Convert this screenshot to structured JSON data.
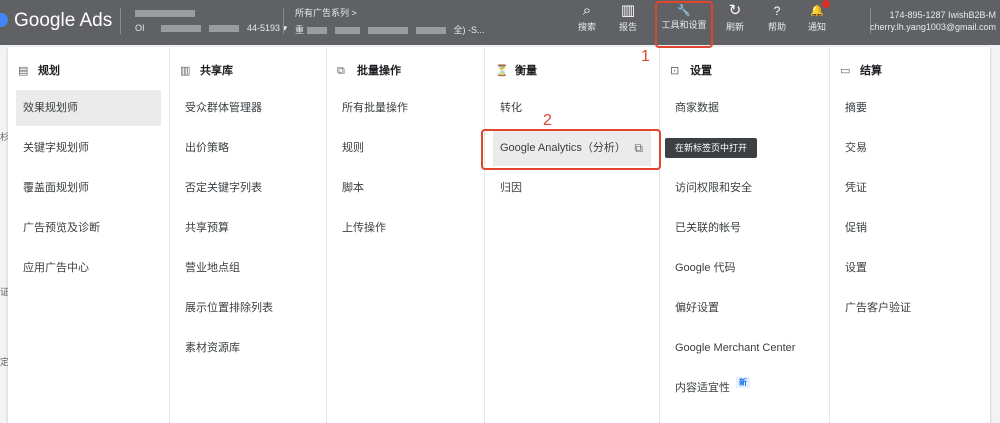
{
  "header": {
    "logo": "Google Ads",
    "account_line1": "",
    "account_line2_prefix": "OI",
    "account_id_suffix": "44-5193",
    "campaign_label": "所有广告系列 >",
    "campaign_name_prefix": "重",
    "campaign_name_suffix": "全) -S...",
    "toolbar": [
      {
        "icon": "search-icon",
        "glyph": "⌕",
        "label": "搜索"
      },
      {
        "icon": "reports-icon",
        "glyph": "▥",
        "label": "报告"
      },
      {
        "icon": "wrench-icon",
        "glyph": "🔧",
        "label": "工具和设置"
      },
      {
        "icon": "refresh-icon",
        "glyph": "↻",
        "label": "刷新"
      },
      {
        "icon": "help-icon",
        "glyph": "?",
        "label": "帮助"
      },
      {
        "icon": "bell-icon",
        "glyph": "🔔",
        "label": "通知"
      }
    ],
    "user_line1": "174-895-1287 IwishB2B-M",
    "user_line2": "cherry.lh.yang1003@gmail.com"
  },
  "menu": {
    "columns": [
      {
        "title": "规划",
        "icon": "calendar-icon",
        "glyph": "▤",
        "items": [
          "效果规划师",
          "关键字规划师",
          "覆盖面规划师",
          "广告预览及诊断",
          "应用广告中心"
        ]
      },
      {
        "title": "共享库",
        "icon": "library-icon",
        "glyph": "▥",
        "items": [
          "受众群体管理器",
          "出价策略",
          "否定关键字列表",
          "共享预算",
          "营业地点组",
          "展示位置排除列表",
          "素材资源库"
        ]
      },
      {
        "title": "批量操作",
        "icon": "copy-icon",
        "glyph": "⧉",
        "items": [
          "所有批量操作",
          "规则",
          "脚本",
          "上传操作"
        ]
      },
      {
        "title": "衡量",
        "icon": "hourglass-icon",
        "glyph": "⏳",
        "items": [
          "转化",
          "Google Analytics（分析）",
          "归因"
        ]
      },
      {
        "title": "设置",
        "icon": "settings-icon",
        "glyph": "⊡",
        "items": [
          "商家数据",
          "",
          "访问权限和安全",
          "已关联的帐号",
          "Google 代码",
          "偏好设置",
          "Google Merchant Center",
          "内容适宜性"
        ]
      },
      {
        "title": "结算",
        "icon": "card-icon",
        "glyph": "▭",
        "items": [
          "摘要",
          "交易",
          "凭证",
          "促销",
          "设置",
          "广告客户验证"
        ]
      }
    ],
    "new_badge": "新",
    "tooltip": "在新标签页中打开",
    "selected_item": "效果规划师"
  },
  "annotations": {
    "step1": "1",
    "step2": "2",
    "color": "#e0452e"
  },
  "side_fragments": [
    "杉",
    "证",
    "定"
  ]
}
